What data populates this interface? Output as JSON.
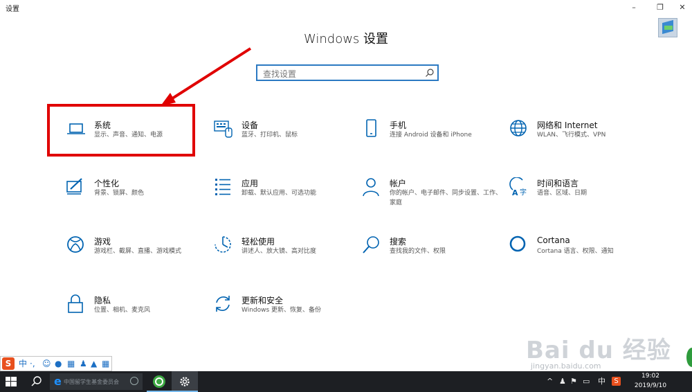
{
  "window": {
    "title": "设置",
    "controls": {
      "minimize": "–",
      "maximize": "❐",
      "close": "✕"
    }
  },
  "heading": "Windows 设置",
  "search": {
    "placeholder": "查找设置"
  },
  "categories": [
    {
      "id": "system",
      "title": "系统",
      "desc": "显示、声音、通知、电源",
      "icon": "laptop-icon"
    },
    {
      "id": "devices",
      "title": "设备",
      "desc": "蓝牙、打印机、鼠标",
      "icon": "keyboard-icon"
    },
    {
      "id": "phone",
      "title": "手机",
      "desc": "连接 Android 设备和 iPhone",
      "icon": "phone-icon"
    },
    {
      "id": "network",
      "title": "网络和 Internet",
      "desc": "WLAN、飞行模式、VPN",
      "icon": "globe-icon"
    },
    {
      "id": "personalization",
      "title": "个性化",
      "desc": "背景、锁屏、颜色",
      "icon": "paint-icon"
    },
    {
      "id": "apps",
      "title": "应用",
      "desc": "卸载、默认应用、可选功能",
      "icon": "apps-list-icon"
    },
    {
      "id": "accounts",
      "title": "帐户",
      "desc": "你的帐户、电子邮件、同步设置、工作、家庭",
      "icon": "person-icon"
    },
    {
      "id": "time-language",
      "title": "时间和语言",
      "desc": "语音、区域、日期",
      "icon": "time-language-icon"
    },
    {
      "id": "gaming",
      "title": "游戏",
      "desc": "游戏栏、截屏、直播、游戏模式",
      "icon": "xbox-icon"
    },
    {
      "id": "ease-of-access",
      "title": "轻松使用",
      "desc": "讲述人、放大镜、高对比度",
      "icon": "ease-of-access-icon"
    },
    {
      "id": "search",
      "title": "搜索",
      "desc": "查找我的文件、权限",
      "icon": "search-icon"
    },
    {
      "id": "cortana",
      "title": "Cortana",
      "desc": "Cortana 语言、权限、通知",
      "icon": "cortana-icon"
    },
    {
      "id": "privacy",
      "title": "隐私",
      "desc": "位置、相机、麦克风",
      "icon": "lock-icon"
    },
    {
      "id": "update",
      "title": "更新和安全",
      "desc": "Windows 更新、恢复、备份",
      "icon": "refresh-icon"
    }
  ],
  "ime": {
    "logo": "S",
    "mode": "中",
    "punct": "·,"
  },
  "watermark": {
    "text": "Bai du 经验",
    "sub": "jingyan.baidu.com"
  },
  "taskbar": {
    "edge_search_text": "中国留学生基金委员会",
    "tray": {
      "up": "^",
      "lang": "中"
    },
    "time": "19:02",
    "date": "2019/9/10"
  },
  "colors": {
    "accent": "#0063b1",
    "highlight": "#e00000",
    "taskbar": "#1d1f23"
  }
}
